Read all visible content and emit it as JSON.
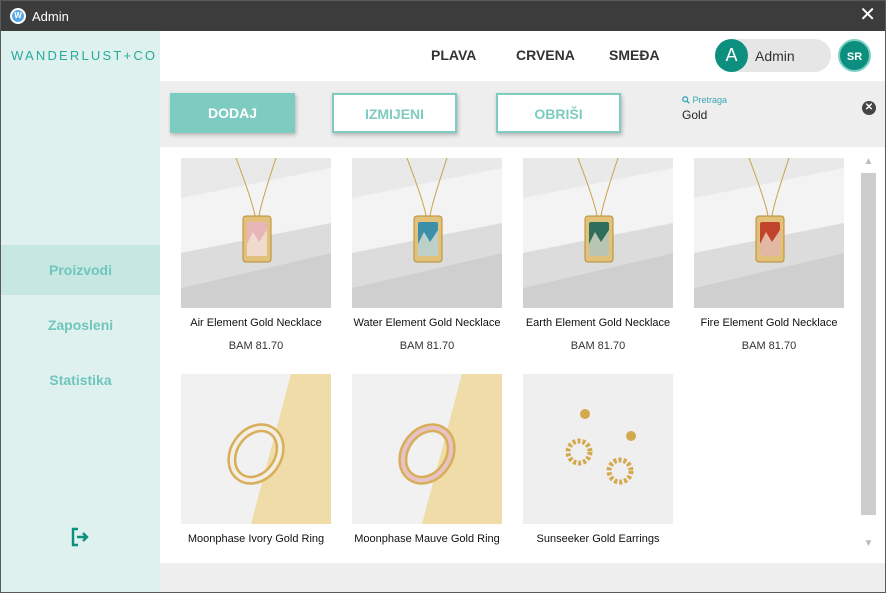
{
  "window": {
    "title": "Admin",
    "app_icon": "W",
    "close": "✕"
  },
  "sidebar": {
    "logo": "WANDERLUST+CO",
    "items": [
      {
        "label": "Proizvodi",
        "active": true
      },
      {
        "label": "Zaposleni",
        "active": false
      },
      {
        "label": "Statistika",
        "active": false
      }
    ],
    "logout_icon": "logout-icon"
  },
  "topnav": {
    "links": [
      "PLAVA",
      "CRVENA",
      "SMEĐA"
    ],
    "avatar_letter": "A",
    "user_name": "Admin",
    "language": "SR"
  },
  "toolbar": {
    "add_label": "DODAJ",
    "edit_label": "IZMIJENI",
    "delete_label": "OBRIŠI",
    "search_label": "Pretraga",
    "search_value": "Gold",
    "clear_icon": "✕"
  },
  "products": [
    {
      "name": "Air Element Gold Necklace",
      "price": "BAM 81.70",
      "type": "necklace",
      "accent": "#e8b6b8"
    },
    {
      "name": "Water Element Gold Necklace",
      "price": "BAM 81.70",
      "type": "necklace",
      "accent": "#3c8fa8"
    },
    {
      "name": "Earth Element Gold Necklace",
      "price": "BAM 81.70",
      "type": "necklace",
      "accent": "#2f6e5a"
    },
    {
      "name": "Fire Element Gold Necklace",
      "price": "BAM 81.70",
      "type": "necklace",
      "accent": "#c0432b"
    },
    {
      "name": "Moonphase Ivory Gold Ring",
      "price": "",
      "type": "ring",
      "accent": "#f3eee4"
    },
    {
      "name": "Moonphase Mauve Gold Ring",
      "price": "",
      "type": "ring",
      "accent": "#e7c3c8"
    },
    {
      "name": "Sunseeker Gold Earrings",
      "price": "",
      "type": "earrings",
      "accent": "#d9b46a"
    }
  ],
  "colors": {
    "teal": "#0d8f80",
    "accent": "#7dcbc1",
    "sidebar": "#dff1ef"
  }
}
